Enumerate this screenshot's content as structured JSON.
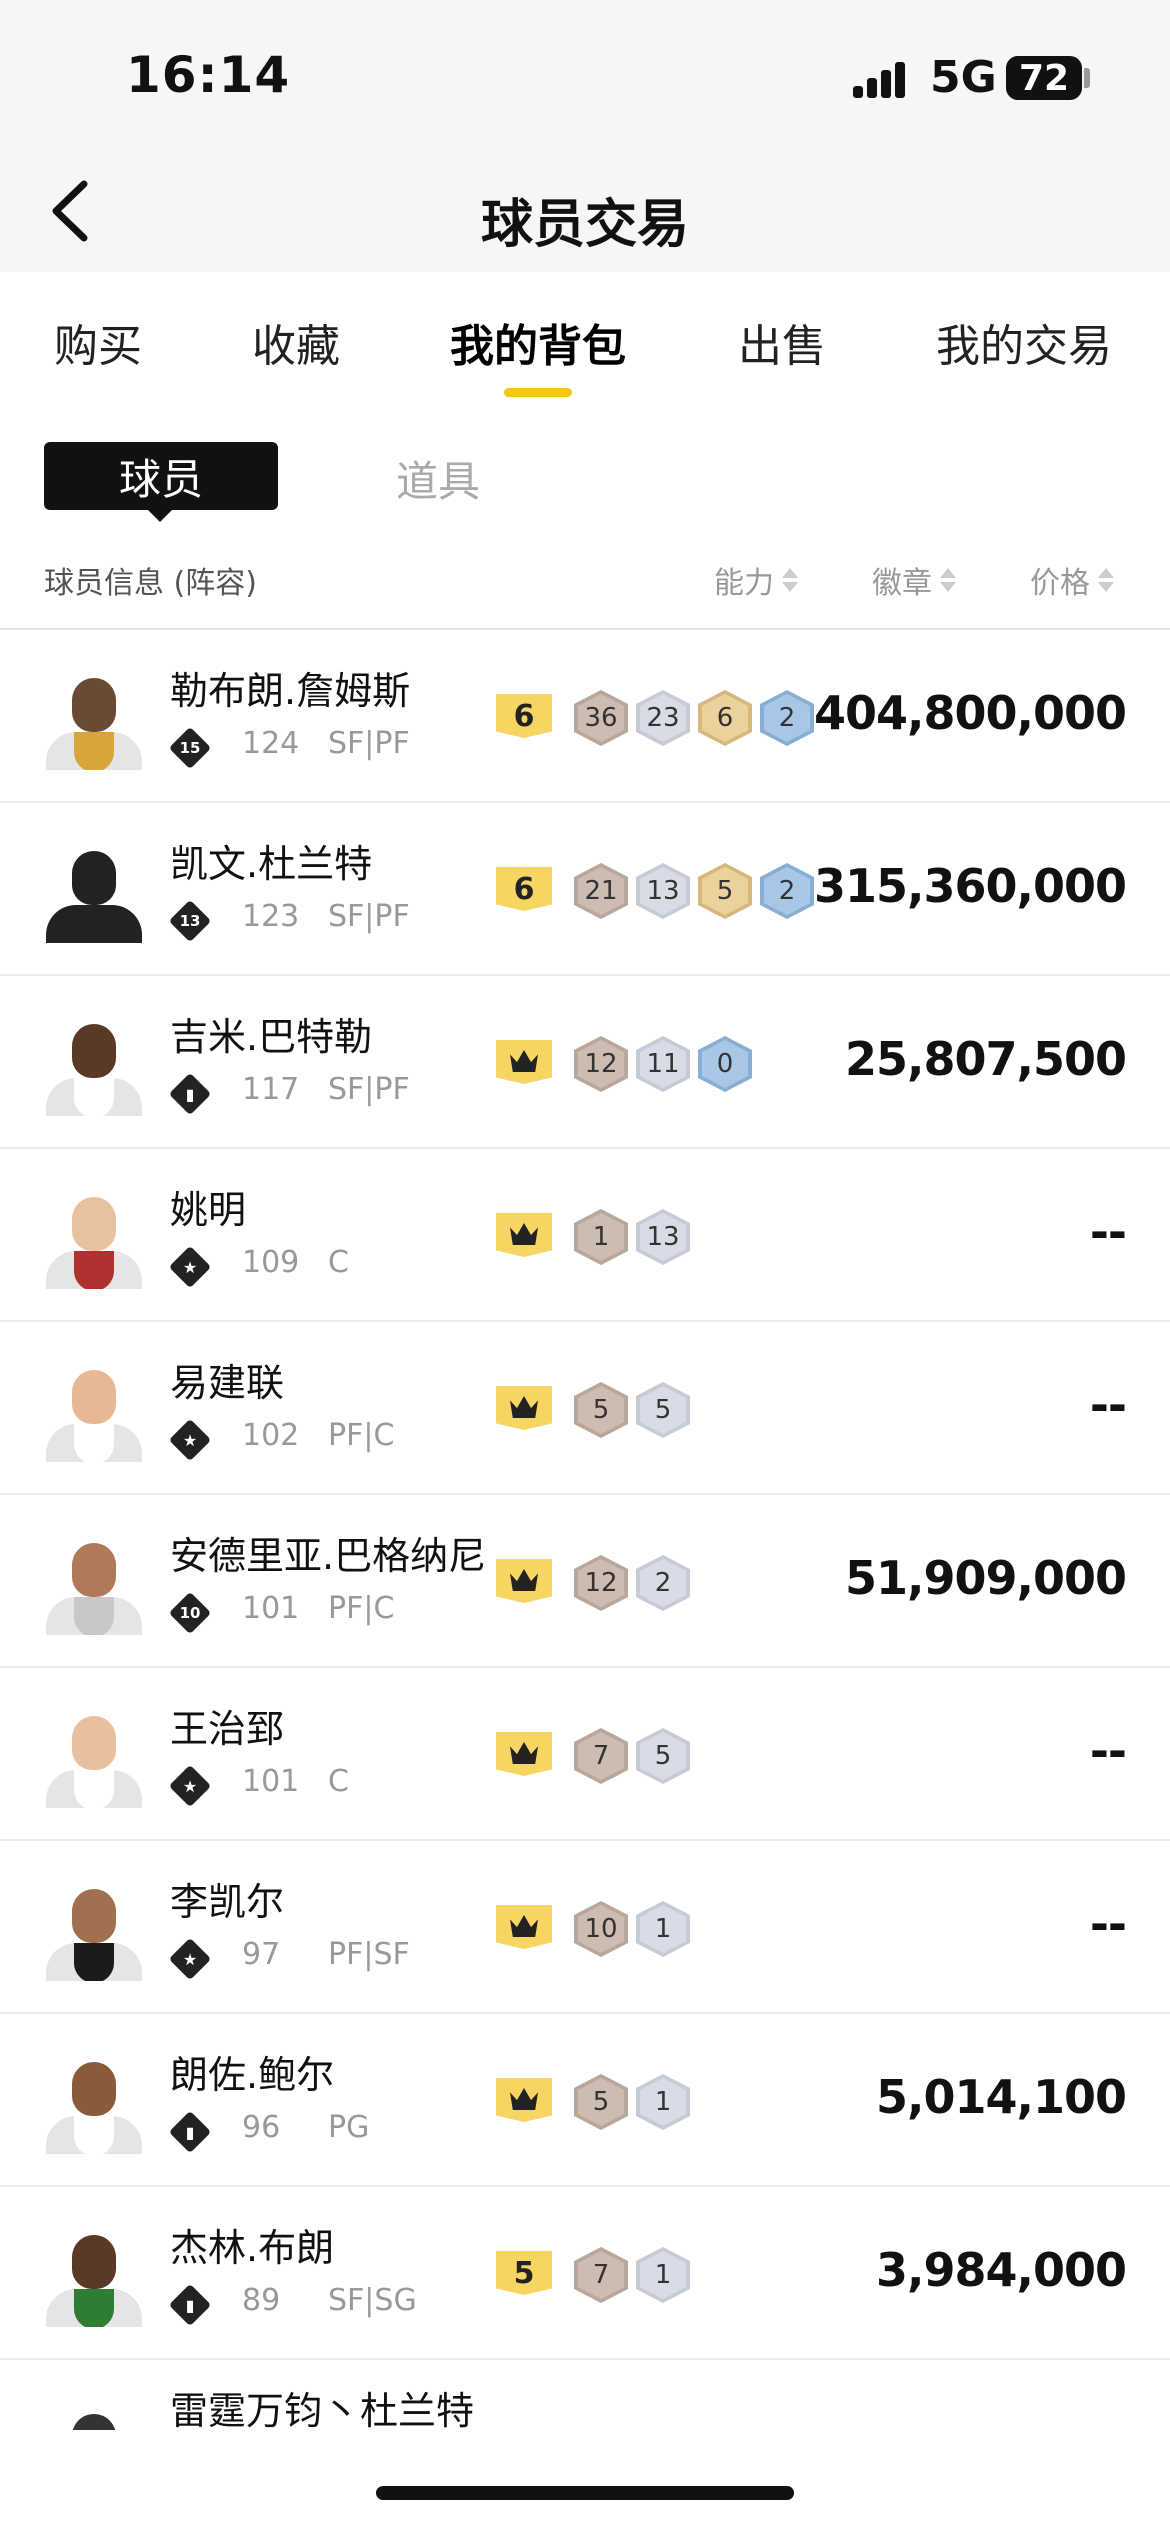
{
  "status_bar": {
    "time": "16:14",
    "network": "5G",
    "battery": "72"
  },
  "nav": {
    "title": "球员交易",
    "back_icon": "chevron-left-icon"
  },
  "tabs": [
    {
      "label": "购买",
      "active": false
    },
    {
      "label": "收藏",
      "active": false
    },
    {
      "label": "我的背包",
      "active": true
    },
    {
      "label": "出售",
      "active": false
    },
    {
      "label": "我的交易",
      "active": false
    }
  ],
  "segments": {
    "players": "球员",
    "items": "道具",
    "selected": "players"
  },
  "header": {
    "info": "球员信息 (阵容)",
    "ability": "能力",
    "badges": "徽章",
    "price": "价格"
  },
  "colors": {
    "accent": "#f5c518",
    "cap_yellow": "#f6d562"
  },
  "players": [
    {
      "name": "勒布朗.詹姆斯",
      "rank_badge": "15",
      "rating": "124",
      "position": "SF|PF",
      "cap": "6",
      "badges": [
        [
          "bronze",
          "36"
        ],
        [
          "silver",
          "23"
        ],
        [
          "gold",
          "6"
        ],
        [
          "blue",
          "2"
        ]
      ],
      "price": "404,800,000"
    },
    {
      "name": "凯文.杜兰特",
      "rank_badge": "13",
      "rating": "123",
      "position": "SF|PF",
      "cap": "6",
      "badges": [
        [
          "bronze",
          "21"
        ],
        [
          "silver",
          "13"
        ],
        [
          "gold",
          "5"
        ],
        [
          "blue",
          "2"
        ]
      ],
      "price": "315,360,000"
    },
    {
      "name": "吉米.巴特勒",
      "rank_badge": "signal-icon",
      "rating": "117",
      "position": "SF|PF",
      "cap": "crown",
      "badges": [
        [
          "bronze",
          "12"
        ],
        [
          "silver",
          "11"
        ],
        [
          "blue",
          "0"
        ]
      ],
      "price": "25,807,500"
    },
    {
      "name": "姚明",
      "rank_badge": "star-icon",
      "rating": "109",
      "position": "C",
      "cap": "crown",
      "badges": [
        [
          "bronze",
          "1"
        ],
        [
          "silver",
          "13"
        ]
      ],
      "price": "--"
    },
    {
      "name": "易建联",
      "rank_badge": "star-icon",
      "rating": "102",
      "position": "PF|C",
      "cap": "crown",
      "badges": [
        [
          "bronze",
          "5"
        ],
        [
          "silver",
          "5"
        ]
      ],
      "price": "--"
    },
    {
      "name": "安德里亚.巴格纳尼",
      "rank_badge": "10",
      "rating": "101",
      "position": "PF|C",
      "cap": "crown",
      "badges": [
        [
          "bronze",
          "12"
        ],
        [
          "silver",
          "2"
        ]
      ],
      "price": "51,909,000"
    },
    {
      "name": "王治郅",
      "rank_badge": "star-icon",
      "rating": "101",
      "position": "C",
      "cap": "crown",
      "badges": [
        [
          "bronze",
          "7"
        ],
        [
          "silver",
          "5"
        ]
      ],
      "price": "--"
    },
    {
      "name": "李凯尔",
      "rank_badge": "star-icon",
      "rating": "97",
      "position": "PF|SF",
      "cap": "crown",
      "badges": [
        [
          "bronze",
          "10"
        ],
        [
          "silver",
          "1"
        ]
      ],
      "price": "--"
    },
    {
      "name": "朗佐.鲍尔",
      "rank_badge": "signal-icon",
      "rating": "96",
      "position": "PG",
      "cap": "crown",
      "badges": [
        [
          "bronze",
          "5"
        ],
        [
          "silver",
          "1"
        ]
      ],
      "price": "5,014,100"
    },
    {
      "name": "杰林.布朗",
      "rank_badge": "signal-icon",
      "rating": "89",
      "position": "SF|SG",
      "cap": "5",
      "badges": [
        [
          "bronze",
          "7"
        ],
        [
          "silver",
          "1"
        ]
      ],
      "price": "3,984,000"
    }
  ],
  "partial_player": {
    "name": "雷霆万钧丶杜兰特"
  }
}
